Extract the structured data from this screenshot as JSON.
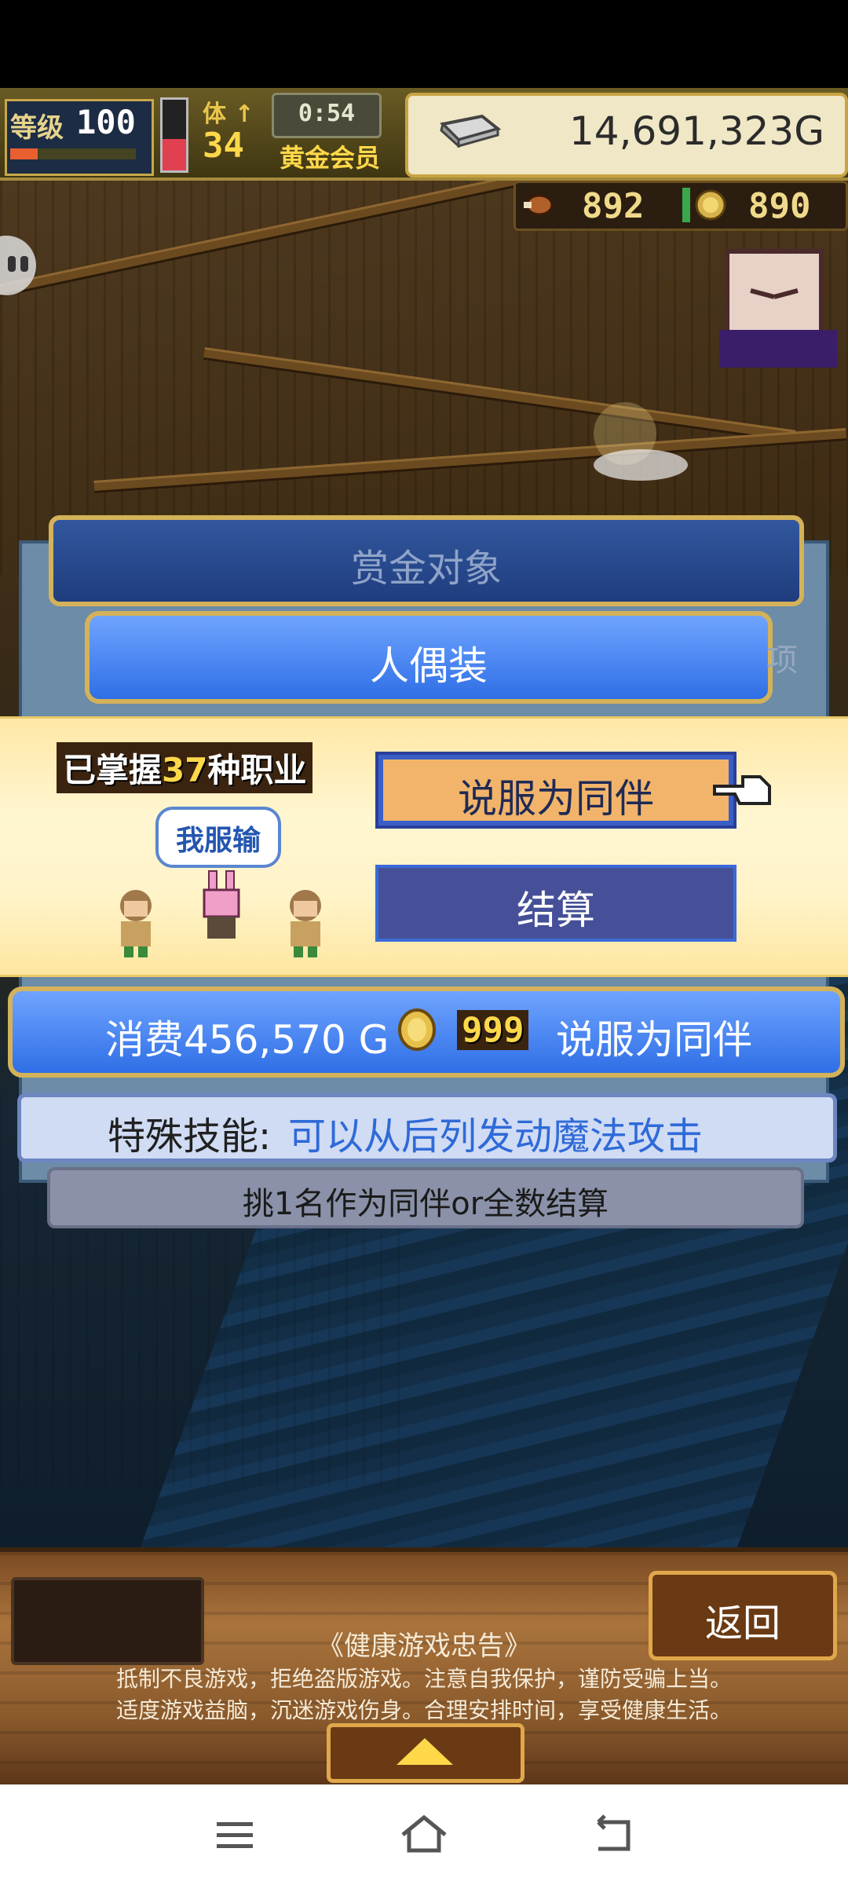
{
  "hud": {
    "level_label": "等级",
    "level_value": "100",
    "exp_fraction": 0.22,
    "hp_fraction": 0.45,
    "floor_label": "体 ↑",
    "floor_value": "34",
    "timer": "0:54",
    "member_label": "黄金会员",
    "gold": "14,691,323G"
  },
  "resources": {
    "resource1_value": "892",
    "resource2_value": "890"
  },
  "dialog": {
    "title": "赏金对象",
    "subtitle": "人偶装",
    "peek_text": "项",
    "jobs_prefix": "已掌握",
    "jobs_count": "37",
    "jobs_suffix": "种职业",
    "speech_bubble": "我服输",
    "persuade_button": "说服为同伴",
    "settle_button": "结算",
    "cost_text": "消费456,570 G",
    "coin_count": "999",
    "cost_action": "说服为同伴",
    "skill_label": "特殊技能:",
    "skill_desc": "可以从后列发动魔法攻击",
    "hint": "挑1名作为同伴or全数结算"
  },
  "bottom": {
    "back_button": "返回",
    "advisory_title": "《健康游戏忠告》",
    "advisory_line1": "抵制不良游戏，拒绝盗版游戏。注意自我保护，谨防受骗上当。",
    "advisory_line2": "适度游戏益脑，沉迷游戏伤身。合理安排时间，享受健康生活。"
  },
  "icons": {
    "ingot": "silver-ingot-icon",
    "coin": "gold-coin-icon",
    "hand": "pointing-hand-icon",
    "nav": [
      "menu-icon",
      "home-icon",
      "back-icon"
    ]
  },
  "colors": {
    "accent_blue": "#2f6fe6",
    "gold_border": "#d4b25a",
    "persuade_fill": "#f2b46a",
    "skill_text": "#2e6ad8"
  }
}
